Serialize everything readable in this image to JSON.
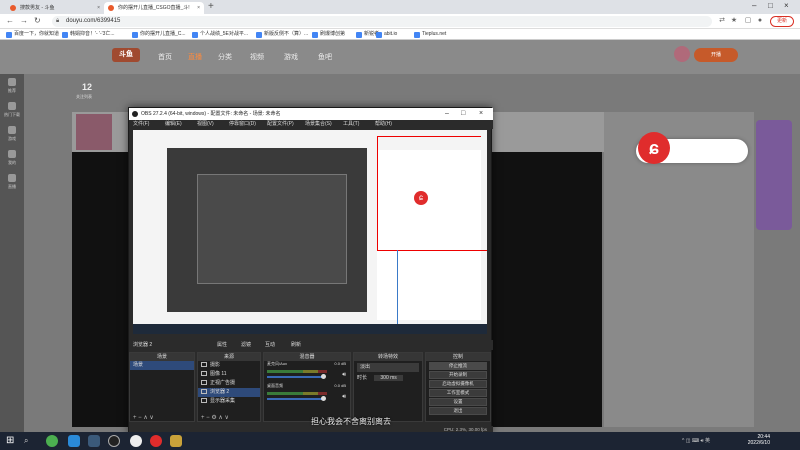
{
  "browser": {
    "tabs": [
      {
        "label": "搜款男友 - 斗鱼"
      },
      {
        "label": "你的摆开儿直播_CSGO直播_斗!"
      }
    ],
    "url": "douyu.com/6399415",
    "update_label": "更新",
    "bookmarks": [
      "百度一下，你就知道",
      "韩娟抑音！'- '-'3亡...",
      "你的摆开儿直播_C...",
      "个人战绩_5E对战平...",
      "新版反侧不（算）...",
      "刷爆博创第",
      "新锐者",
      "abit.io",
      "Tieplus.net"
    ]
  },
  "site": {
    "logo": "斗鱼",
    "nav": [
      "首页",
      "直播",
      "分类",
      "视频",
      "游戏",
      "鱼吧"
    ],
    "live_button": "开播",
    "follow_count": "12",
    "follow_label": "关注列表",
    "rail": [
      "推荐",
      "热门下载",
      "游戏",
      "我的",
      "直播"
    ]
  },
  "obs": {
    "title": "OBS 27.2.4 (64-bit, windows) - 配置文件: 未命名 - 场景: 未命名",
    "menu": [
      "文件(F)",
      "编辑(E)",
      "视图(V)",
      "停靠窗口(D)",
      "配置文件(P)",
      "场景集合(S)",
      "工具(T)",
      "帮助(H)"
    ],
    "ctrl": [
      "浏览器 2",
      "属性",
      "滤镜",
      "互动",
      "刷新"
    ],
    "docks": {
      "scenes": {
        "title": "场景",
        "items": [
          "场景"
        ]
      },
      "sources": {
        "title": "来源",
        "items": [
          "摄影",
          "图像 11",
          "正视广告摄",
          "浏览器 2",
          "显示器采集"
        ]
      },
      "mixer": {
        "title": "混音器",
        "tracks": [
          {
            "name": "麦克风/Aux",
            "db": "0.0 dB"
          },
          {
            "name": "桌面音频",
            "db": "0.0 dB"
          }
        ]
      },
      "transitions": {
        "title": "转场特效",
        "type": "淡出",
        "duration_label": "时长",
        "duration": "300 ms"
      },
      "controls": {
        "title": "控制",
        "buttons": [
          "停止推流",
          "开始录制",
          "启动虚拟摄像机",
          "工作室模式",
          "设置",
          "退出"
        ]
      }
    },
    "status": "CPU: 2.3%, 30.00 fps"
  },
  "subtitle": "担心我会不舍离别离去",
  "taskbar": {
    "time": "20:44",
    "date": "2022/6/10"
  }
}
